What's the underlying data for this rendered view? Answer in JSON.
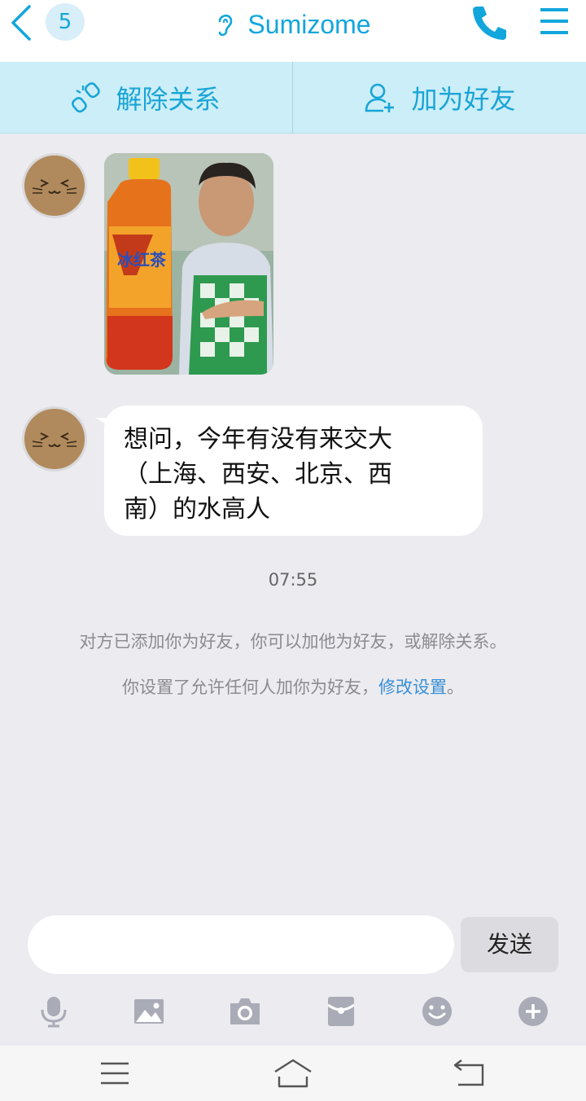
{
  "header": {
    "unread_count": "5",
    "title": "Sumizome",
    "icons": [
      "back-icon",
      "ear-icon",
      "phone-icon",
      "menu-icon"
    ]
  },
  "actions": {
    "remove_label": "解除关系",
    "add_friend_label": "加为好友"
  },
  "messages": [
    {
      "type": "image",
      "sender": "Sumizome"
    },
    {
      "type": "text",
      "sender": "Sumizome",
      "lines": [
        "想问，今年有没有来交大",
        "（上海、西安、北京、西",
        "南）的水高人"
      ]
    }
  ],
  "timestamp": "07:55",
  "system": {
    "notice": "对方已添加你为好友，你可以加他为好友，或解除关系。",
    "settings_prefix": "你设置了允许任何人加你为好友，",
    "settings_link": "修改设置",
    "settings_suffix": "。"
  },
  "composer": {
    "placeholder": "",
    "send_label": "发送"
  },
  "toolbar_icons": [
    "microphone-icon",
    "image-icon",
    "camera-icon",
    "red-packet-icon",
    "emoji-icon",
    "plus-icon"
  ],
  "nav_icons": [
    "menu-nav-icon",
    "home-nav-icon",
    "back-nav-icon"
  ],
  "colors": {
    "accent": "#12a6dc",
    "action_bar": "#cbeef8",
    "background": "#ebebf0",
    "icon_gray": "#a9abb6"
  }
}
